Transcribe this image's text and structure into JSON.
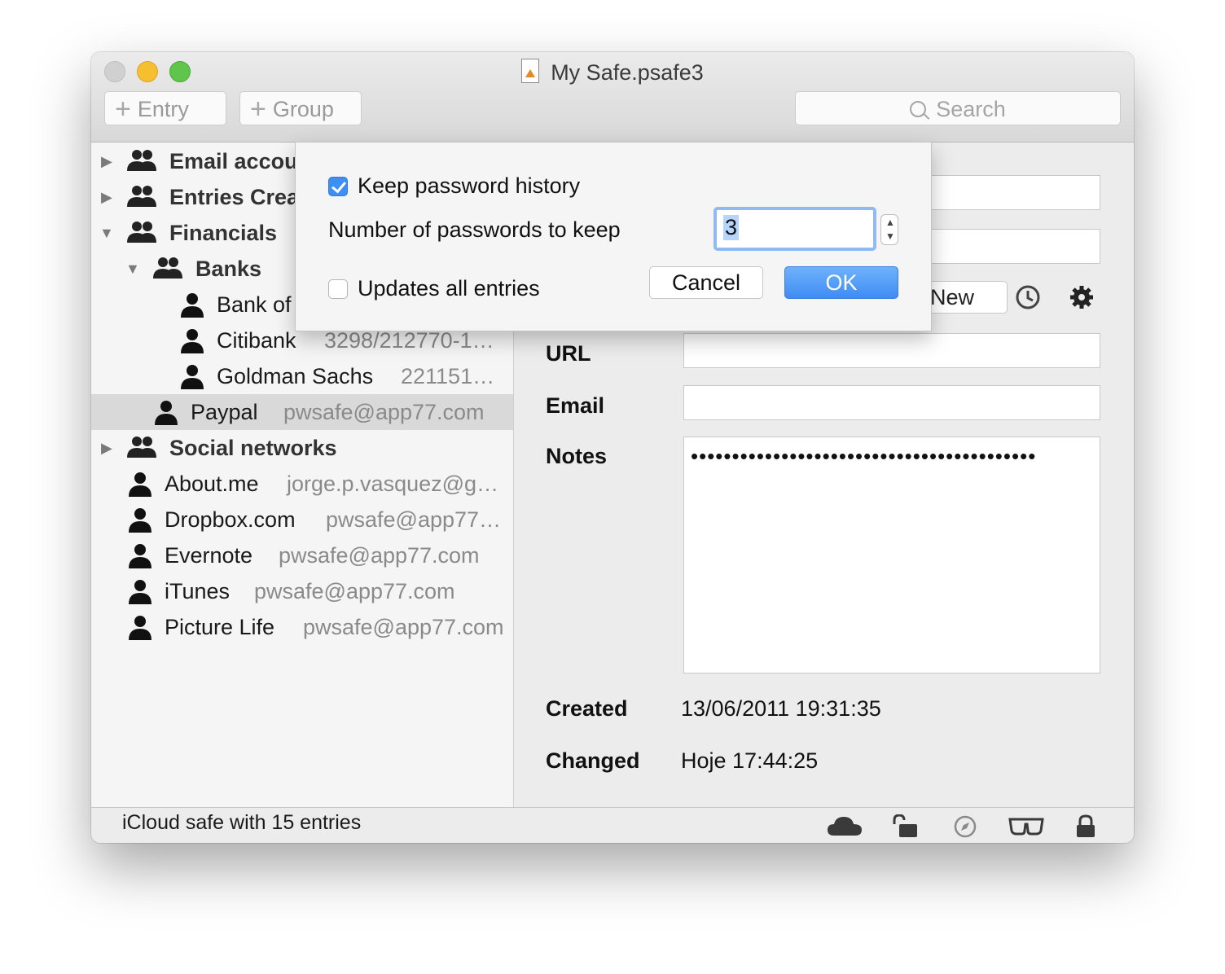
{
  "window": {
    "title": "My Safe.psafe3"
  },
  "toolbar": {
    "entry_label": "Entry",
    "group_label": "Group",
    "search_placeholder": "Search"
  },
  "sidebar": {
    "groups": [
      {
        "label": "Email accou"
      },
      {
        "label": "Entries Crea"
      },
      {
        "label": "Financials"
      },
      {
        "label": "Banks"
      },
      {
        "label": "Social networks"
      }
    ],
    "entries": [
      {
        "label": "Bank of",
        "sub": ""
      },
      {
        "label": "Citibank",
        "sub": "3298/212770-1…"
      },
      {
        "label": "Goldman Sachs",
        "sub": "221151…"
      },
      {
        "label": "Paypal",
        "sub": "pwsafe@app77.com"
      },
      {
        "label": "About.me",
        "sub": "jorge.p.vasquez@g…"
      },
      {
        "label": "Dropbox.com",
        "sub": "pwsafe@app77…"
      },
      {
        "label": "Evernote",
        "sub": "pwsafe@app77.com"
      },
      {
        "label": "iTunes",
        "sub": "pwsafe@app77.com"
      },
      {
        "label": "Picture Life",
        "sub": "pwsafe@app77.com"
      }
    ]
  },
  "detail": {
    "new_label": "New",
    "url_label": "URL",
    "email_label": "Email",
    "notes_label": "Notes",
    "notes_value": "••••••••••••••••••••••••••••••••••••••••••",
    "created_label": "Created",
    "created_value": "13/06/2011 19:31:35",
    "changed_label": "Changed",
    "changed_value": "Hoje 17:44:25"
  },
  "sheet": {
    "keep_history_label": "Keep password history",
    "keep_history_checked": true,
    "number_label": "Number of passwords to keep",
    "number_value": "3",
    "updates_all_label": "Updates all entries",
    "updates_all_checked": false,
    "cancel_label": "Cancel",
    "ok_label": "OK"
  },
  "status": {
    "text": "iCloud safe with 15 entries"
  },
  "colors": {
    "accent": "#3d8ef5",
    "selection": "#d9d9d9"
  }
}
